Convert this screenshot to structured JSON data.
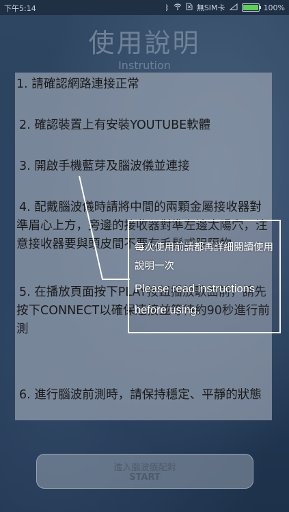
{
  "status_bar": {
    "time": "下午5:14",
    "bluetooth_icon": "bluetooth-icon",
    "wifi_icon": "wifi-icon",
    "sim_icon": "sim-icon",
    "carrier": "無SIM卡",
    "battery_percent": "100%",
    "battery_level": 1.0
  },
  "page": {
    "title": "使用說明",
    "subtitle": "Instrution"
  },
  "steps": [
    "1. 請確認網路連接正常",
    "2. 確認裝置上有安裝YOUTUBE軟體",
    "3. 開啟手機藍芽及腦波儀並連接",
    "4. 配戴腦波儀時請將中間的兩顆金屬接收器對準眉心上方，旁邊的接收器對準左邊太陽穴，注意接收器要與頭皮間不要有毛髮或阻隔物",
    "5. 在播放頁面按下PLAY按鈕播放歌曲前，請先按下CONNECT以確保連接並等待約90秒進行前測",
    "6. 進行腦波前測時，請保持穩定、平靜的狀態"
  ],
  "tip": {
    "zh": "每次使用前請都再詳細閱讀使用說明一次",
    "en": "Please read instructions before using."
  },
  "start_button": {
    "label_zh": "進入腦波儀配對",
    "label_en": "START"
  },
  "colors": {
    "battery_fill": "#5fcf5a",
    "tip_border": "#f4f4f4"
  }
}
